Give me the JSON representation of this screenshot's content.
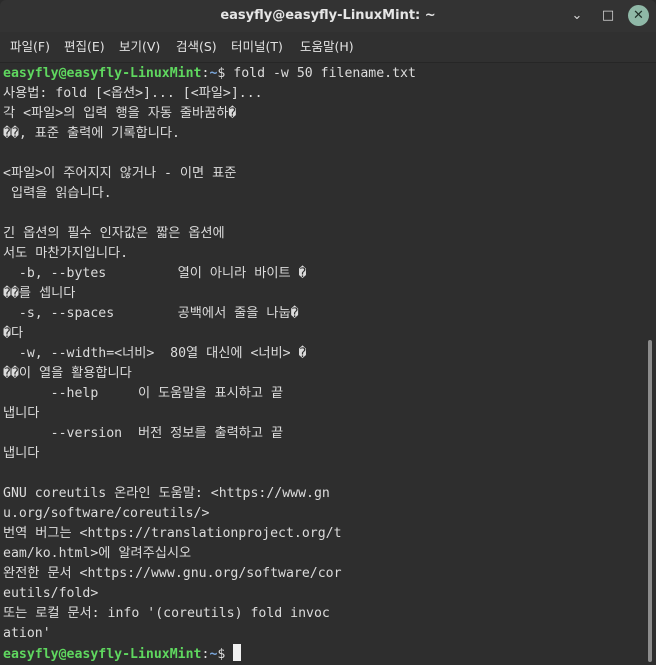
{
  "window": {
    "title": "easyfly@easyfly-LinuxMint: ~",
    "minimize_glyph": "⌄",
    "maximize_glyph": "□",
    "close_glyph": "✕"
  },
  "menu": [
    "파일(F)",
    "편집(E)",
    "보기(V)",
    "검색(S)",
    "터미널(T)",
    "도움말(H)"
  ],
  "prompt": {
    "user_host": "easyfly@easyfly-LinuxMint",
    "sep": ":",
    "path": "~",
    "symbol": "$ "
  },
  "command": "fold -w 50 filename.txt",
  "output": [
    "사용법: fold [<옵션>]... [<파일>]...",
    "각 <파일>의 입력 행을 자동 줄바꿈하�",
    "��, 표준 출력에 기록합니다.",
    "",
    "<파일>이 주어지지 않거나 - 이면 표준",
    " 입력을 읽습니다.",
    "",
    "긴 옵션의 필수 인자값은 짧은 옵션에",
    "서도 마찬가지입니다.",
    "  -b, --bytes         열이 아니라 바이트 �",
    "��를 셉니다",
    "  -s, --spaces        공백에서 줄을 나눕�",
    "�다",
    "  -w, --width=<너비>  80열 대신에 <너비> �",
    "��이 열을 활용합니다",
    "      --help     이 도움말을 표시하고 끝",
    "냅니다",
    "      --version  버전 정보를 출력하고 끝",
    "냅니다",
    "",
    "GNU coreutils 온라인 도움말: <https://www.gn",
    "u.org/software/coreutils/>",
    "번역 버그는 <https://translationproject.org/t",
    "eam/ko.html>에 알려주십시오",
    "완전한 문서 <https://www.gnu.org/software/cor",
    "eutils/fold>",
    "또는 로컬 문서: info '(coreutils) fold invoc",
    "ation'"
  ],
  "colors": {
    "prompt_user": "#5fd75f",
    "prompt_path": "#7aa6da",
    "text": "#dcdcdc",
    "background": "#2e2e2e"
  }
}
